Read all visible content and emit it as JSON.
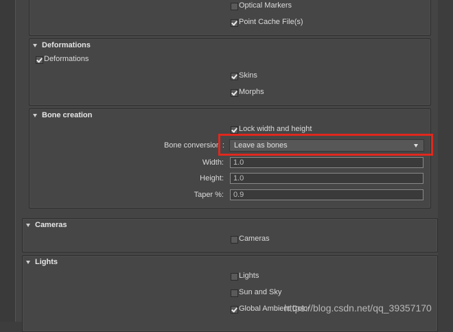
{
  "top": {
    "optical_markers": {
      "label": "Optical Markers",
      "checked": false
    },
    "point_cache": {
      "label": "Point Cache File(s)",
      "checked": true
    }
  },
  "deformations": {
    "title": "Deformations",
    "main": {
      "label": "Deformations",
      "checked": true
    },
    "skins": {
      "label": "Skins",
      "checked": true
    },
    "morphs": {
      "label": "Morphs",
      "checked": true
    }
  },
  "bone_creation": {
    "title": "Bone creation",
    "lock": {
      "label": "Lock width and height",
      "checked": true
    },
    "conversion_label": "Bone conversion :",
    "conversion_value": "Leave as bones",
    "width_label": "Width:",
    "width_value": "1.0",
    "height_label": "Height:",
    "height_value": "1.0",
    "taper_label": "Taper %:",
    "taper_value": "0.9"
  },
  "cameras": {
    "title": "Cameras",
    "main": {
      "label": "Cameras",
      "checked": false
    }
  },
  "lights": {
    "title": "Lights",
    "main": {
      "label": "Lights",
      "checked": false
    },
    "sun_sky": {
      "label": "Sun and Sky",
      "checked": false
    },
    "ambient": {
      "label": "Global Ambient Color",
      "checked": true
    }
  },
  "highlight_color": "#e0281d",
  "watermark": "https://blog.csdn.net/qq_39357170"
}
